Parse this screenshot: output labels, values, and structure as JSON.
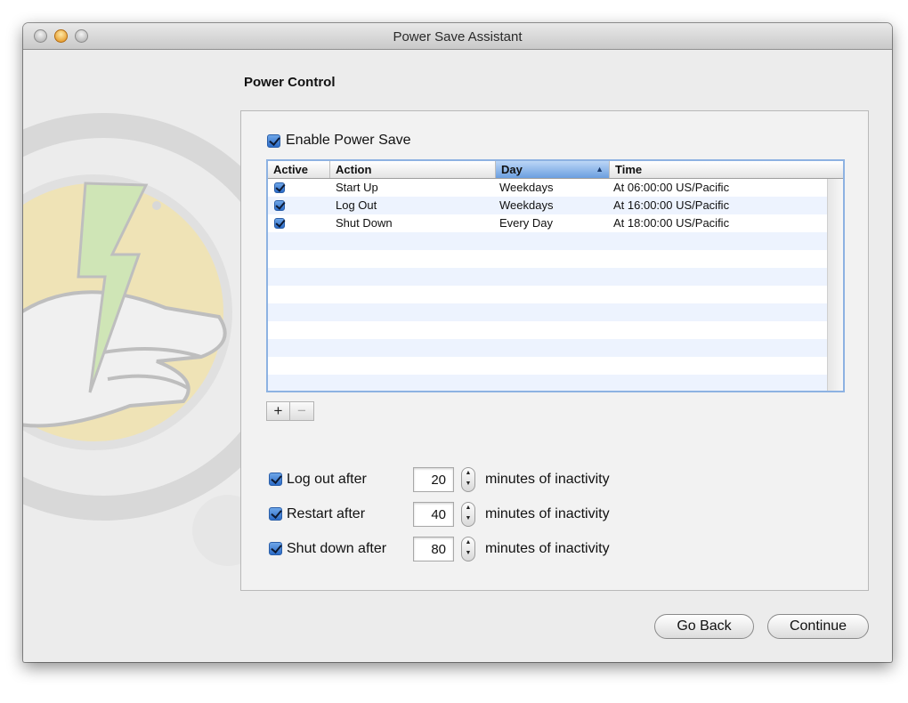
{
  "window": {
    "title": "Power Save Assistant"
  },
  "section": {
    "title": "Power Control"
  },
  "enable": {
    "label": "Enable Power Save",
    "checked": true
  },
  "table": {
    "columns": [
      "Active",
      "Action",
      "Day",
      "Time"
    ],
    "sorted_column": "Day",
    "rows": [
      {
        "active": true,
        "action": "Start Up",
        "day": "Weekdays",
        "time": "At 06:00:00 US/Pacific"
      },
      {
        "active": true,
        "action": "Log Out",
        "day": "Weekdays",
        "time": "At 16:00:00 US/Pacific"
      },
      {
        "active": true,
        "action": "Shut Down",
        "day": "Every Day",
        "time": "At 18:00:00 US/Pacific"
      }
    ]
  },
  "add_remove": {
    "add": "+",
    "remove": "−"
  },
  "options": [
    {
      "label": "Log out after",
      "value": "20",
      "suffix": "minutes of inactivity",
      "checked": true
    },
    {
      "label": "Restart after",
      "value": "40",
      "suffix": "minutes of inactivity",
      "checked": true
    },
    {
      "label": "Shut down after",
      "value": "80",
      "suffix": "minutes of inactivity",
      "checked": true
    }
  ],
  "buttons": {
    "back": "Go Back",
    "continue": "Continue"
  },
  "colors": {
    "accent": "#2c6cc8",
    "selection": "#8db2e2"
  }
}
